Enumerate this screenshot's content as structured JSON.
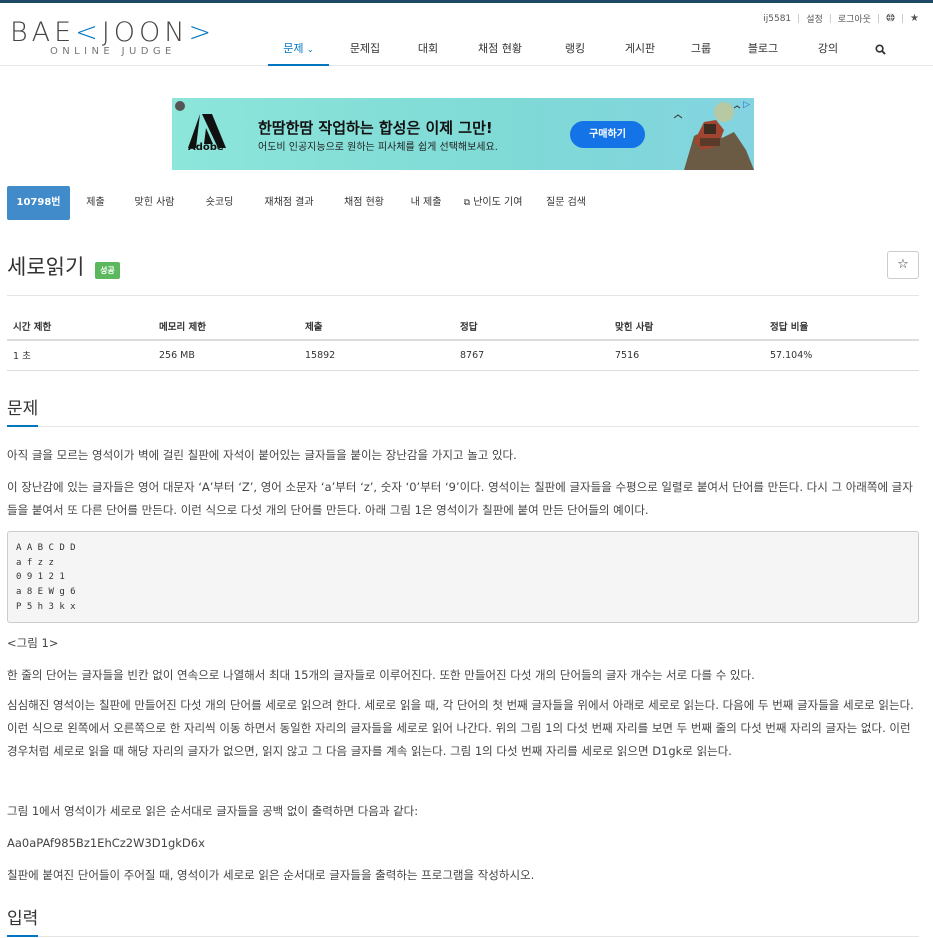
{
  "brand": {
    "logo_main_left": "BAE",
    "logo_k1": "<",
    "logo_mid": "JOON",
    "logo_k2": ">",
    "logo_sub": "ONLINE JUDGE"
  },
  "userbar": {
    "username": "ij5581",
    "settings": "설정",
    "logout": "로그아웃"
  },
  "nav": [
    {
      "label": "문제",
      "active": true
    },
    {
      "label": "문제집"
    },
    {
      "label": "대회"
    },
    {
      "label": "채점 현황"
    },
    {
      "label": "랭킹"
    },
    {
      "label": "게시판"
    },
    {
      "label": "그룹"
    },
    {
      "label": "블로그"
    },
    {
      "label": "강의"
    }
  ],
  "ad": {
    "brand": "Adobe",
    "title": "한땀한땀 작업하는 합성은 이제 그만!",
    "subtitle": "어도비 인공지능으로 원하는 피사체를 쉽게 선택해보세요.",
    "button": "구매하기"
  },
  "subtabs": [
    {
      "label": "10798번",
      "active": true
    },
    {
      "label": "제출"
    },
    {
      "label": "맞힌 사람"
    },
    {
      "label": "숏코딩"
    },
    {
      "label": "재채점 결과"
    },
    {
      "label": "채점 현황"
    },
    {
      "label": "내 제출"
    },
    {
      "label": "난이도 기여"
    },
    {
      "label": "질문 검색"
    }
  ],
  "problem": {
    "title": "세로읽기",
    "badge": "성공",
    "info_headers": [
      "시간 제한",
      "메모리 제한",
      "제출",
      "정답",
      "맞힌 사람",
      "정답 비율"
    ],
    "info_values": [
      "1 초",
      "256 MB",
      "15892",
      "8767",
      "7516",
      "57.104%"
    ]
  },
  "section_problem": "문제",
  "section_input": "입력",
  "paragraphs": {
    "p1": "아직 글을 모르는 영석이가 벽에 걸린 칠판에 자석이 붙어있는 글자들을 붙이는 장난감을 가지고 놀고 있다.",
    "p2": "이 장난감에 있는 글자들은 영어 대문자 ‘A’부터 ‘Z’, 영어 소문자 ‘a’부터 ‘z’, 숫자 ‘0’부터 ‘9’이다. 영석이는 칠판에 글자들을 수평으로 일렬로 붙여서 단어를 만든다. 다시 그 아래쪽에 글자들을 붙여서 또 다른 단어를 만든다. 이런 식으로 다섯 개의 단어를 만든다. 아래 그림 1은 영석이가 칠판에 붙여 만든 단어들의 예이다.",
    "example": "A A B C D D\na f z z\n0 9 1 2 1\na 8 E W g 6\nP 5 h 3 k x",
    "figure_caption": "<그림 1>",
    "p3": "한 줄의 단어는 글자들을 빈칸 없이 연속으로 나열해서 최대 15개의 글자들로 이루어진다. 또한 만들어진 다섯 개의 단어들의 글자 개수는 서로 다를 수 있다.",
    "p4": "심심해진 영석이는 칠판에 만들어진 다섯 개의 단어를 세로로 읽으려 한다. 세로로 읽을 때, 각 단어의 첫 번째 글자들을 위에서 아래로 세로로 읽는다. 다음에 두 번째 글자들을 세로로 읽는다. 이런 식으로 왼쪽에서 오른쪽으로 한 자리씩 이동 하면서 동일한 자리의 글자들을 세로로 읽어 나간다. 위의 그림 1의 다섯 번째 자리를 보면 두 번째 줄의 다섯 번째 자리의 글자는 없다. 이런 경우처럼 세로로 읽을 때 해당 자리의 글자가 없으면, 읽지 않고 그 다음 글자를 계속 읽는다. 그림 1의 다섯 번째 자리를 세로로 읽으면 D1gk로 읽는다.",
    "p5": "그림 1에서 영석이가 세로로 읽은 순서대로 글자들을 공백 없이 출력하면 다음과 같다:",
    "p6": "Aa0aPAf985Bz1EhCz2W3D1gkD6x",
    "p7": "칠판에 붙여진 단어들이 주어질 때, 영석이가 세로로 읽은 순서대로 글자들을 출력하는 프로그램을 작성하시오."
  },
  "colors": {
    "accent": "#0076c0",
    "success": "#5cb85c",
    "tab_active": "#428bca"
  }
}
